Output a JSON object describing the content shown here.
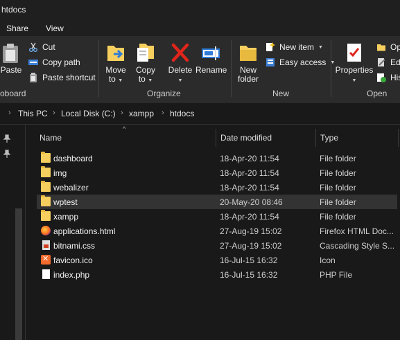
{
  "window": {
    "title": "htdocs"
  },
  "ribbon_tabs": [
    {
      "label": "Share"
    },
    {
      "label": "View"
    }
  ],
  "clipboard": {
    "paste_label": "Paste",
    "cut_label": "Cut",
    "copy_path_label": "Copy path",
    "paste_shortcut_label": "Paste shortcut",
    "group_label": "oboard"
  },
  "organize": {
    "move_to_line1": "Move",
    "move_to_line2": "to",
    "copy_to_line1": "Copy",
    "copy_to_line2": "to",
    "delete_label": "Delete",
    "rename_label": "Rename",
    "group_label": "Organize"
  },
  "new": {
    "new_folder_line1": "New",
    "new_folder_line2": "folder",
    "new_item_label": "New item",
    "easy_access_label": "Easy access",
    "group_label": "New"
  },
  "open": {
    "properties_label": "Properties",
    "open_label": "Op",
    "edit_label": "Edi",
    "history_label": "His",
    "group_label": "Open"
  },
  "breadcrumb": [
    {
      "label": "This PC"
    },
    {
      "label": "Local Disk (C:)"
    },
    {
      "label": "xampp"
    },
    {
      "label": "htdocs"
    }
  ],
  "columns": {
    "name": "Name",
    "date": "Date modified",
    "type": "Type"
  },
  "files": [
    {
      "name": "dashboard",
      "date": "18-Apr-20 11:54",
      "type": "File folder",
      "icon": "folder-icon"
    },
    {
      "name": "img",
      "date": "18-Apr-20 11:54",
      "type": "File folder",
      "icon": "folder-icon"
    },
    {
      "name": "webalizer",
      "date": "18-Apr-20 11:54",
      "type": "File folder",
      "icon": "folder-icon"
    },
    {
      "name": "wptest",
      "date": "20-May-20 08:46",
      "type": "File folder",
      "icon": "folder-icon",
      "selected": true
    },
    {
      "name": "xampp",
      "date": "18-Apr-20 11:54",
      "type": "File folder",
      "icon": "folder-icon"
    },
    {
      "name": "applications.html",
      "date": "27-Aug-19 15:02",
      "type": "Firefox HTML Doc...",
      "icon": "firefox-icon"
    },
    {
      "name": "bitnami.css",
      "date": "27-Aug-19 15:02",
      "type": "Cascading Style S...",
      "icon": "css-file-icon"
    },
    {
      "name": "favicon.ico",
      "date": "16-Jul-15 16:32",
      "type": "Icon",
      "icon": "xampp-icon"
    },
    {
      "name": "index.php",
      "date": "16-Jul-15 16:32",
      "type": "PHP File",
      "icon": "file-icon"
    }
  ]
}
